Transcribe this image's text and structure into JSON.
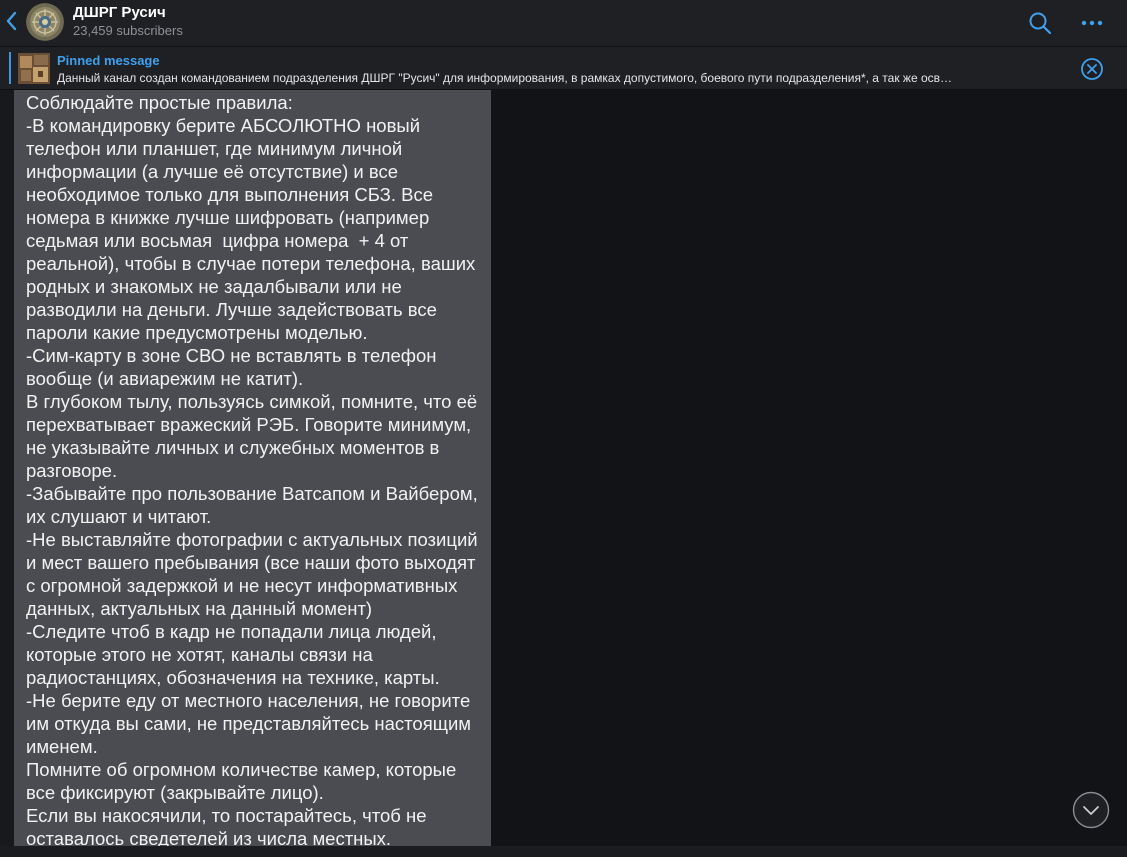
{
  "header": {
    "channel_name": "ДШРГ Русич",
    "subscribers": "23,459 subscribers",
    "icons": {
      "back": "chevron-left-icon",
      "search": "search-icon",
      "more": "more-icon"
    }
  },
  "pinned": {
    "title": "Pinned message",
    "text": "Данный канал создан командованием подразделения ДШРГ \"Русич\" для информирования, в рамках допустимого, боевого пути подразделения*, а так же осв…",
    "close_icon": "close-circle-icon"
  },
  "message": {
    "text": "Соблюдайте простые правила:\n-В командировку берите АБСОЛЮТНО новый\nтелефон или планшет, где минимум личной\nинформации (а лучше её отсутствие) и все\nнеобходимое только для выполнения СБЗ. Все\nномера в книжке лучше шифровать (например\nседьмая или восьмая  цифра номера  + 4 от\nреальной), чтобы в случае потери телефона, ваших\nродных и знакомых не задалбывали или не\nразводили на деньги. Лучше задействовать все\nпароли какие предусмотрены моделью.\n-Сим-карту в зоне СВО не вставлять в телефон\nвообще (и авиарежим не катит).\nВ глубоком тылу, пользуясь симкой, помните, что её\nперехватывает вражеский РЭБ. Говорите минимум,\nне указывайте личных и служебных моментов в\nразговоре.\n-Забывайте про пользование Ватсапом и Вайбером,\nих слушают и читают.\n-Не выставляйте фотографии с актуальных позиций\nи мест вашего пребывания (все наши фото выходят\nс огромной задержкой и не несут информативных\nданных, актуальных на данный момент)\n-Следите чтоб в кадр не попадали лица людей,\nкоторые этого не хотят, каналы связи на\nрадиостанциях, обозначения на технике, карты.\n-Не берите еду от местного населения, не говорите\nим откуда вы сами, не представляйтесь настоящим\nименем.\nПомните об огромном количестве камер, которые\nвсе фиксируют (закрывайте лицо).\nЕсли вы накосячили, то постарайтесь, чтоб не\nоставалось сведетелей из числа местных."
  },
  "scroll_icon": "chevron-down-circle-icon",
  "colors": {
    "accent": "#3b9ae8",
    "bubble": "#4a4c51",
    "background": "#121316",
    "header": "#1e2024"
  }
}
